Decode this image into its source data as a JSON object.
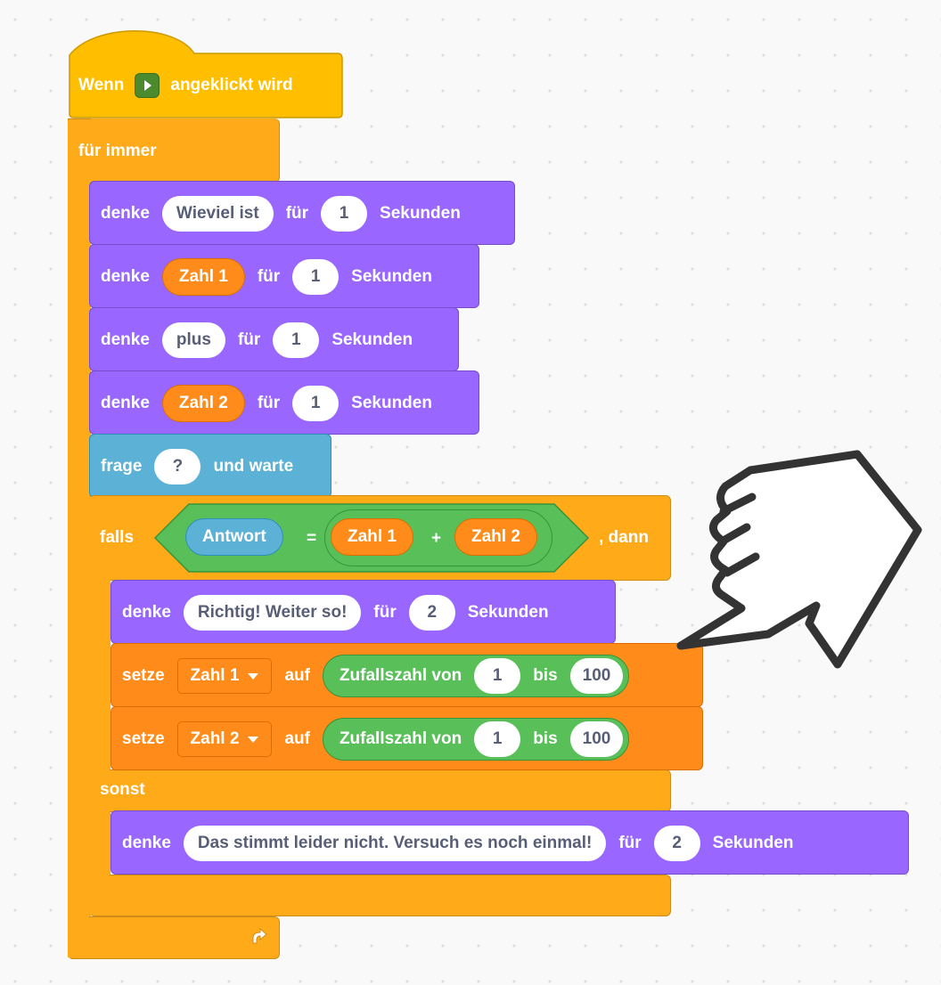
{
  "hat": {
    "prefix": "Wenn",
    "suffix": "angeklickt wird",
    "flag_icon": "green-flag-icon"
  },
  "forever": {
    "label": "für immer",
    "loop_icon": "loop-arrow-icon"
  },
  "think1": {
    "verb": "denke",
    "message": "Wieviel ist",
    "for": "für",
    "secs": "1",
    "unit": "Sekunden"
  },
  "think2": {
    "verb": "denke",
    "message": "Zahl 1",
    "for": "für",
    "secs": "1",
    "unit": "Sekunden"
  },
  "think3": {
    "verb": "denke",
    "message": "plus",
    "for": "für",
    "secs": "1",
    "unit": "Sekunden"
  },
  "think4": {
    "verb": "denke",
    "message": "Zahl 2",
    "for": "für",
    "secs": "1",
    "unit": "Sekunden"
  },
  "ask": {
    "verb": "frage",
    "question": "?",
    "suffix": "und warte"
  },
  "ifelse": {
    "if_label": "falls",
    "then_label": ", dann",
    "else_label": "sonst",
    "cond": {
      "left": "Antwort",
      "op": "=",
      "a": "Zahl 1",
      "plus": "+",
      "b": "Zahl 2"
    }
  },
  "think5": {
    "verb": "denke",
    "message": "Richtig! Weiter so!",
    "for": "für",
    "secs": "2",
    "unit": "Sekunden"
  },
  "set1": {
    "verb": "setze",
    "var": "Zahl 1",
    "to": "auf",
    "rand": "Zufallszahl von",
    "from": "1",
    "bis": "bis",
    "to_val": "100"
  },
  "set2": {
    "verb": "setze",
    "var": "Zahl 2",
    "to": "auf",
    "rand": "Zufallszahl von",
    "from": "1",
    "bis": "bis",
    "to_val": "100"
  },
  "think6": {
    "verb": "denke",
    "message": "Das stimmt leider nicht. Versuch es noch einmal!",
    "for": "für",
    "secs": "2",
    "unit": "Sekunden"
  },
  "colors": {
    "control": "#ffab19",
    "looks": "#9966ff",
    "sensing": "#5cb1d6",
    "variables": "#ff8c1a",
    "operators": "#59c059"
  },
  "pointer": {
    "icon": "hand-pointer-icon"
  }
}
